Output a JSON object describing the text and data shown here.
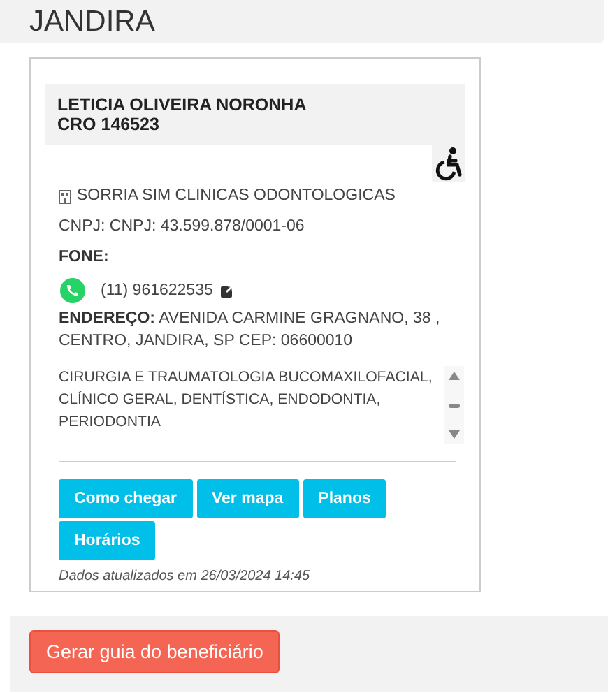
{
  "city": "JANDIRA",
  "provider": {
    "name": "LETICIA OLIVEIRA NORONHA",
    "cro": "CRO 146523",
    "clinic": "SORRIA SIM CLINICAS ODONTOLOGICAS",
    "cnpj": "CNPJ: CNPJ: 43.599.878/0001-06",
    "phone_label": "FONE:",
    "phone": "(11) 961622535",
    "address_label": "ENDEREÇO:",
    "address": "AVENIDA CARMINE GRAGNANO, 38 , CENTRO, JANDIRA, SP CEP: 06600010",
    "specialties": "CIRURGIA E TRAUMATOLOGIA BUCOMAXILOFACIAL, CLÍNICO GERAL, DENTÍSTICA, ENDODONTIA, PERIODONTIA",
    "buttons": [
      "Como chegar",
      "Ver mapa",
      "Planos",
      "Horários"
    ],
    "updated": "Dados atualizados em 26/03/2024 14:45"
  },
  "footer_button": "Gerar guia do beneficiário"
}
